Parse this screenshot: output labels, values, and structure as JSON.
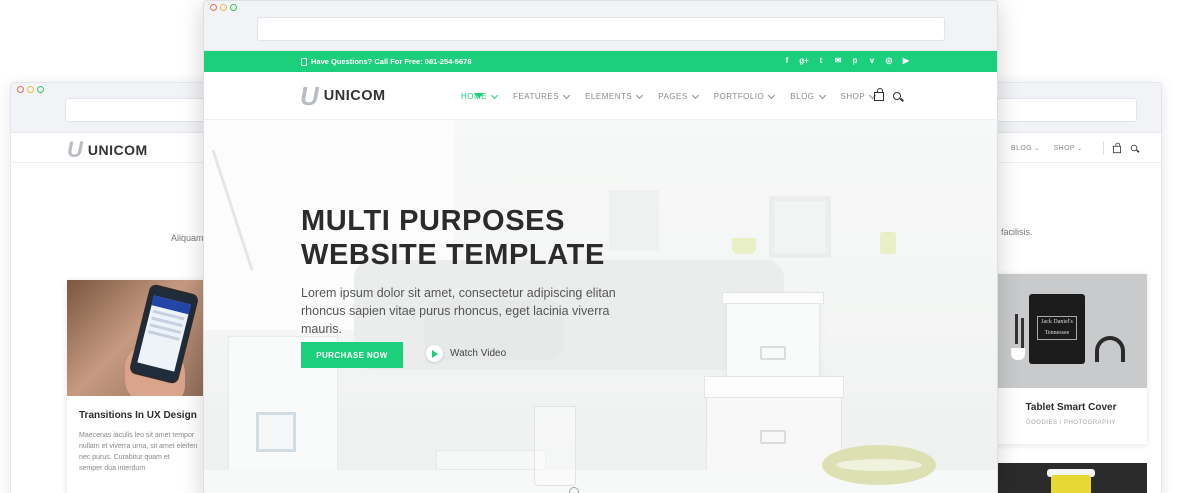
{
  "back_window": {
    "logo_mark": "U",
    "logo_text": "UNICOM",
    "menu": [
      "BLOG",
      "SHOP"
    ],
    "left_text_fragment": "Aliquam",
    "right_text_fragment": "facilisis.",
    "card_left": {
      "title": "Transitions In UX Design",
      "body": "Maecenas iaculis leo sit amet tempor\nnullam et viverra urna, sit amet eleifen\nnec purus. Curabitur quam et\nsemper dua interdum"
    },
    "card_right": {
      "title": "Tablet Smart Cover",
      "tags": "GOODIES / PHOTOGRAPHY",
      "tee_label": "Jack Daniel's Tennessee"
    }
  },
  "front_window": {
    "topbar": {
      "contact_text": "Have Questions? Call For Free: 081-254-5678",
      "socials": [
        {
          "icon": "facebook-icon",
          "glyph": "f"
        },
        {
          "icon": "google-plus-icon",
          "glyph": "g+"
        },
        {
          "icon": "twitter-icon",
          "glyph": "t"
        },
        {
          "icon": "email-icon",
          "glyph": "✉"
        },
        {
          "icon": "pinterest-icon",
          "glyph": "p"
        },
        {
          "icon": "vimeo-icon",
          "glyph": "v"
        },
        {
          "icon": "dribbble-icon",
          "glyph": "◎"
        },
        {
          "icon": "youtube-icon",
          "glyph": "▶"
        }
      ]
    },
    "nav": {
      "logo_mark": "U",
      "logo_text": "UNICOM",
      "items": [
        "HOME",
        "FEATURES",
        "ELEMENTS",
        "PAGES",
        "PORTFOLIO",
        "BLOG",
        "SHOP"
      ],
      "active": "HOME"
    },
    "hero": {
      "title_line1": "MULTI PURPOSES",
      "title_line2": "WEBSITE TEMPLATE",
      "subtitle": "Lorem ipsum dolor sit amet, consectetur adipiscing elitan rhoncus sapien vitae purus rhoncus, eget lacinia viverra mauris.",
      "cta_label": "PURCHASE NOW",
      "video_label": "Watch Video"
    }
  },
  "colors": {
    "accent": "#1ccf7b",
    "dot_red": "#f26b5b",
    "dot_yellow": "#f5b83d",
    "dot_green": "#37c05e"
  }
}
